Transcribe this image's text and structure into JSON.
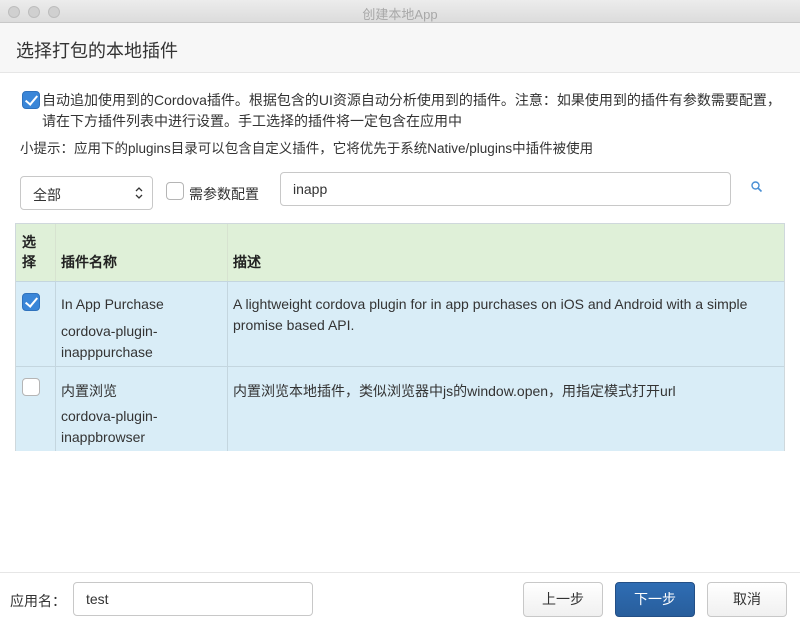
{
  "window": {
    "title": "创建本地App"
  },
  "header": {
    "title": "选择打包的本地插件"
  },
  "auto_add": {
    "checked": true,
    "line1": "自动追加使用到的Cordova插件。根据包含的UI资源自动分析使用到的插件。注意：如果使用到的插件有参数需要配置，",
    "line2": "请在下方插件列表中进行设置。手工选择的插件将一定包含在应用中"
  },
  "tip": "小提示：应用下的plugins目录可以包含自定义插件，它将优先于系统Native/plugins中插件被使用",
  "filter": {
    "category_selected": "全部",
    "needs_params_label": "需参数配置",
    "needs_params_checked": false,
    "search_value": "inapp",
    "search_icon": "search-icon"
  },
  "table": {
    "headers": {
      "select_line1": "选",
      "select_line2": "择",
      "name": "插件名称",
      "desc": "描述"
    },
    "rows": [
      {
        "checked": true,
        "name_line1": "In App Purchase",
        "name_line2": "cordova-plugin-",
        "name_line3": "inapppurchase",
        "desc_line1": "A lightweight cordova plugin for in app purchases on iOS and Android with a simple",
        "desc_line2": "promise based API."
      },
      {
        "checked": false,
        "name_line1": "内置浏览",
        "name_line2": "cordova-plugin-",
        "name_line3": "inappbrowser",
        "desc_line1": "内置浏览本地插件，类似浏览器中js的window.open，用指定模式打开url",
        "desc_line2": ""
      }
    ]
  },
  "footer": {
    "app_name_label": "应用名：",
    "app_name_value": "test",
    "prev_label": "上一步",
    "next_label": "下一步",
    "cancel_label": "取消"
  },
  "colors": {
    "primary": "#2f6db4",
    "header_row": "#dff0d8",
    "data_row": "#d9edf7",
    "checkbox": "#3a86d8"
  }
}
